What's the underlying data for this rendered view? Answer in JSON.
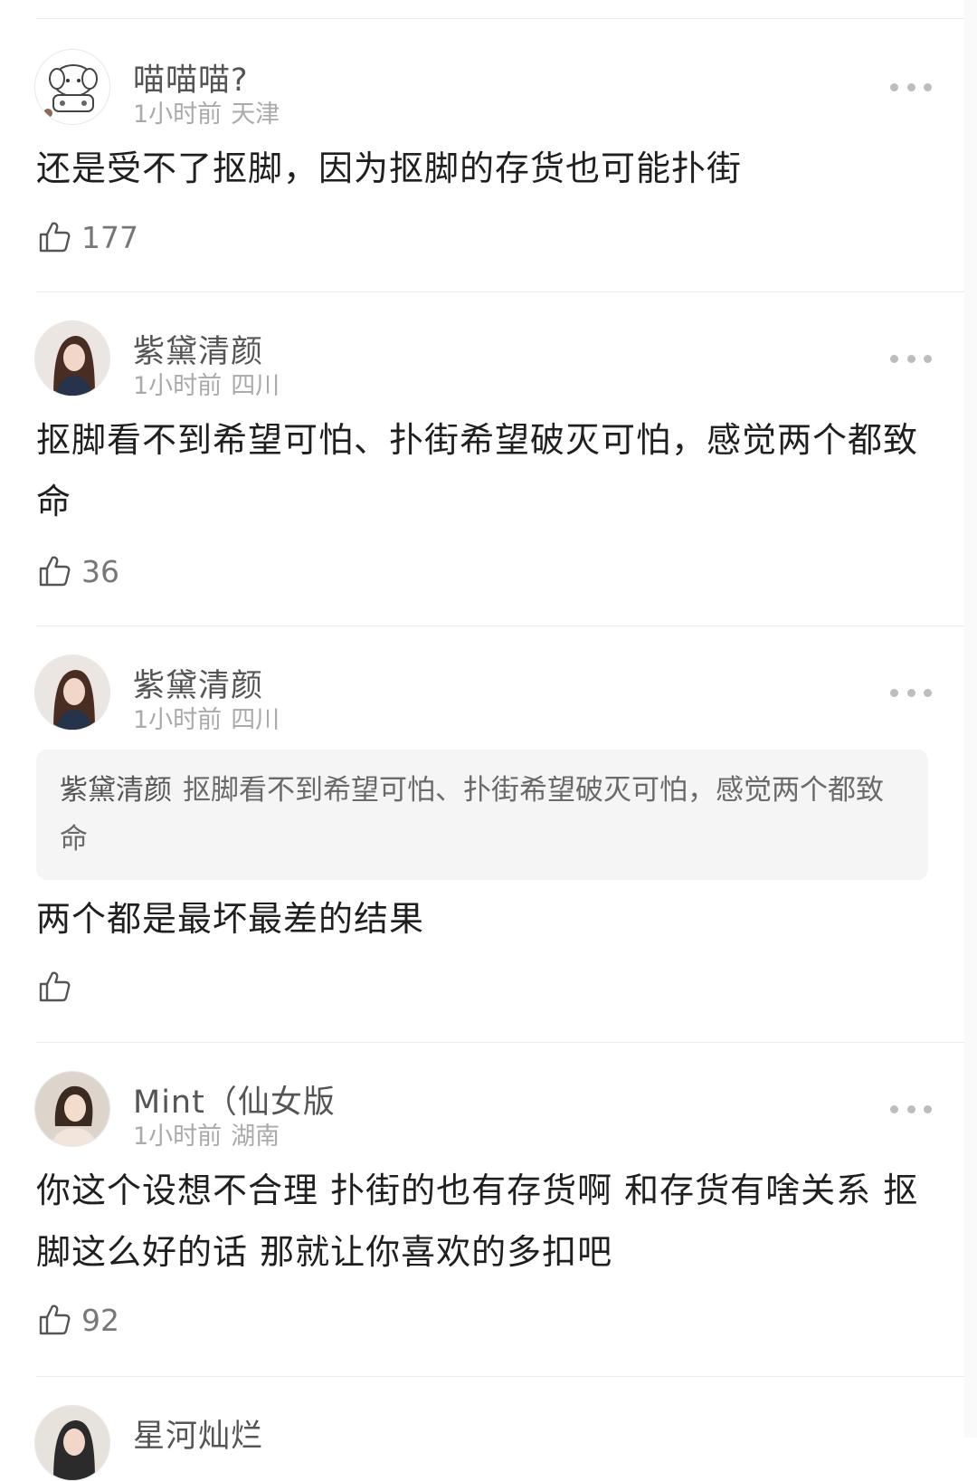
{
  "comments": [
    {
      "username": "喵喵喵?",
      "time": "1小时前",
      "location": "天津",
      "text": "还是受不了抠脚，因为抠脚的存货也可能扑街",
      "likes": "177",
      "avatar_icon": "cartoon-puppy-icon"
    },
    {
      "username": "紫黛清颜",
      "time": "1小时前",
      "location": "四川",
      "text": "抠脚看不到希望可怕、扑街希望破灭可怕，感觉两个都致命",
      "likes": "36",
      "avatar_icon": "woman-portrait-avatar"
    },
    {
      "username": "紫黛清颜",
      "time": "1小时前",
      "location": "四川",
      "quote_name": "紫黛清颜",
      "quote_text": "抠脚看不到希望可怕、扑街希望破灭可怕，感觉两个都致命",
      "text": "两个都是最坏最差的结果",
      "likes": "",
      "avatar_icon": "woman-portrait-avatar"
    },
    {
      "username": "Mint（仙女版",
      "time": "1小时前",
      "location": "湖南",
      "text": "你这个设想不合理 扑街的也有存货啊 和存货有啥关系 抠脚这么好的话 那就让你喜欢的多扣吧",
      "likes": "92",
      "avatar_icon": "woman-portrait-avatar"
    },
    {
      "username": "星河灿烂",
      "avatar_icon": "woman-portrait-avatar"
    }
  ],
  "icons": {
    "like": "thumbs-up-outline-icon",
    "more": "more-dots-icon"
  }
}
